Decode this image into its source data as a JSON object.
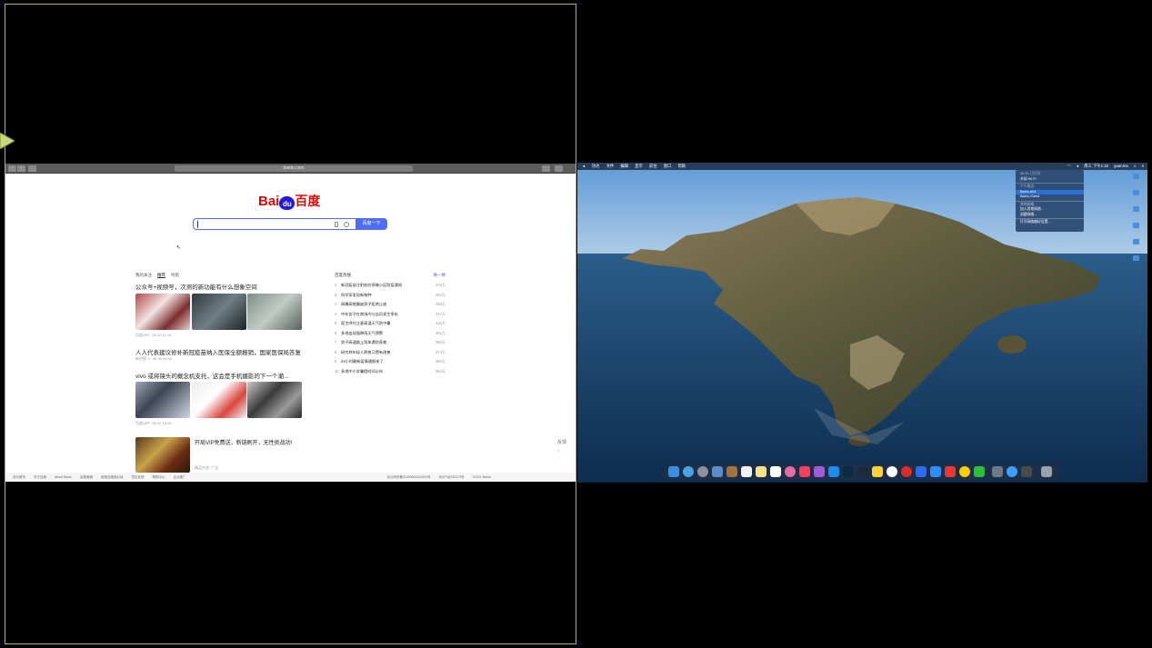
{
  "browser": {
    "url": "baidu.com"
  },
  "baidu": {
    "logo_latin": "Bai",
    "logo_paw_text": "du",
    "logo_chinese": "百度",
    "search_placeholder": "",
    "search_button": "百度一下"
  },
  "feed": {
    "tabs": [
      "我的关注",
      "推荐",
      "导航"
    ],
    "active_tab": 1,
    "items": [
      {
        "title": "公众号+视频号，次测的新功能有什么想象空间",
        "source": "百度APP",
        "time": "06-30 11:18"
      },
      {
        "title": "人人代表建议修补新冠疫苗纳入医保全额报销，国家医保局答复",
        "source": "新京报 ✔",
        "time": "06-30 09:58"
      },
      {
        "title": "vivo 或将镜头的概念机支托，这会是手机摄影的下一个潮...",
        "source": "百度APP",
        "time": "06-30 16:34"
      },
      {
        "title": "开局VIP免费送，新链刷开，无性挑战功!",
        "source": "精品在途",
        "time": "广告"
      }
    ]
  },
  "hot": {
    "title": "百度热搜",
    "refresh": "换一换",
    "items": [
      {
        "rank": "1",
        "text": "新冠疫苗注射前应停做小区防疫通知",
        "heat": "479万"
      },
      {
        "rank": "2",
        "text": "科学家发现新物种",
        "heat": "453万"
      },
      {
        "rank": "3",
        "text": "网曝高铁霸座男子拒绝让座",
        "heat": "448万"
      },
      {
        "rank": "4",
        "text": "中年女子在商场内与店员发生争执",
        "heat": "437万"
      },
      {
        "rank": "5",
        "text": "医生呼吁注意高温天气防中暑",
        "heat": "416万"
      },
      {
        "rank": "6",
        "text": "多地出现强降雨天气预警",
        "heat": "401万"
      },
      {
        "rank": "7",
        "text": "男子高速路上驾车遇险获救",
        "heat": "388万"
      },
      {
        "rank": "8",
        "text": "研究称年轻人熬夜习惯有改善",
        "heat": "374万"
      },
      {
        "rank": "9",
        "text": "24小时最新疫情通报来了",
        "heat": "366万"
      },
      {
        "rank": "10",
        "text": "多地中小学暑假时间公布",
        "heat": "353万"
      }
    ]
  },
  "side_tools": {
    "feedback": "反馈",
    "top": "↑"
  },
  "footer": {
    "links": [
      "设为首页",
      "关于百度",
      "About Baidu",
      "百度营销",
      "使用百度前必读",
      "意见反馈",
      "帮助中心",
      "企业推广"
    ],
    "right": [
      "京公网安备11000002000001号",
      "京ICP证030173号",
      "©2021 Baidu"
    ]
  },
  "mac": {
    "menubar_left": [
      "",
      "访达",
      "文件",
      "编辑",
      "显示",
      "前往",
      "窗口",
      "帮助"
    ],
    "menubar_right": [
      "周三 下午1:18",
      "guanma"
    ],
    "status_menu": [
      {
        "text": "Wi-Fi: 已打开",
        "type": "header"
      },
      {
        "text": "关闭 Wi-Fi",
        "type": "item"
      },
      {
        "text": "个人热点",
        "type": "header"
      },
      {
        "text": "Baidu-A01",
        "type": "hl"
      },
      {
        "text": "Baidu-Guest",
        "type": "item"
      },
      {
        "text": "其他网络",
        "type": "header"
      },
      {
        "text": "加入其他网络...",
        "type": "item"
      },
      {
        "text": "创建网络...",
        "type": "item"
      },
      {
        "text": "打开网络偏好设置...",
        "type": "item"
      }
    ]
  },
  "colors": {
    "pane_border": "#b5b821",
    "baidu_red": "#e10602",
    "baidu_blue": "#4e6ef2"
  }
}
